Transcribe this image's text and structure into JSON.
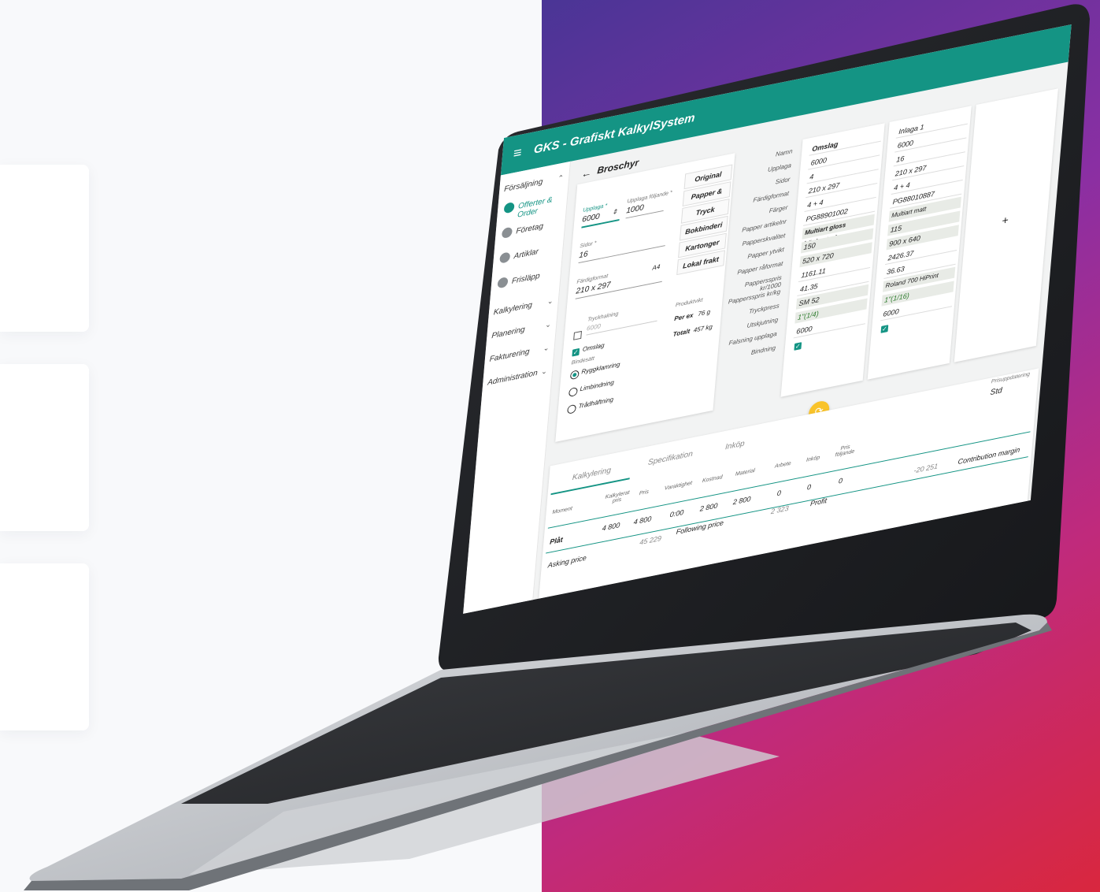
{
  "app": {
    "title": "GKS - Grafiskt KalkylSystem",
    "page_title": "Broschyr"
  },
  "sidebar": {
    "items": [
      {
        "label": "Försäljning"
      },
      {
        "label": "Offerter & Order"
      },
      {
        "label": "Företag"
      },
      {
        "label": "Artiklar"
      },
      {
        "label": "Frisläpp"
      },
      {
        "label": "Kalkylering"
      },
      {
        "label": "Planering"
      },
      {
        "label": "Fakturering"
      },
      {
        "label": "Administration"
      }
    ]
  },
  "form": {
    "upplaga_label": "Upplaga *",
    "upplaga_value": "6000",
    "upplaga_foljande_label": "Upplaga följande *",
    "upplaga_foljande_value": "1000",
    "sidor_label": "Sidor *",
    "sidor_value": "16",
    "fardigformat_label": "Färdigformat",
    "fardigformat_value": "210 x 297",
    "fardigformat_suffix": "A4",
    "tryckhalning_label": "Tryckhalning",
    "tryckhalning_value": "6000",
    "omslag_label": "Omslag",
    "bindesatt_label": "Bindesätt",
    "radio1": "Ryggklamring",
    "radio2": "Limbindning",
    "radio3": "Trådhäftning",
    "produktvikt_label": "Produktvikt",
    "per_ex_label": "Per ex",
    "per_ex_value": "76 g",
    "totalt_label": "Totalt",
    "totalt_value": "457 kg"
  },
  "buttons": [
    "Original",
    "Papper & Färg",
    "Tryck",
    "Bokbinderi",
    "Kartonger",
    "Lokal frakt"
  ],
  "row_labels": [
    "Namn",
    "Upplaga",
    "Sidor",
    "Färdigformat",
    "Färger",
    "Papper artikelnr",
    "Papperskvalitet",
    "Papper ytvikt",
    "Papper råformat",
    "Pappersspris kr/1000",
    "Pappersspris kr/kg",
    "Tryckpress",
    "Utskjutning",
    "Falsning upplaga",
    "Bindning"
  ],
  "omslag": [
    "Omslag",
    "6000",
    "4",
    "210 x 297",
    "4 + 4",
    "PG88901002",
    "Multiart gloss högbestruk",
    "150",
    "520 x 720",
    "1161.11",
    "41.35",
    "SM 52",
    "1\"(1/4)",
    "6000"
  ],
  "inlaga": [
    "Inlaga 1",
    "6000",
    "16",
    "210 x 297",
    "4 + 4",
    "PG88010887",
    "Multiart matt",
    "115",
    "900 x 640",
    "2426.37",
    "36.63",
    "Roland 700 HiPrint",
    "1\"(1/16)",
    "6000"
  ],
  "add_column": "+",
  "tabs": [
    "Kalkylering",
    "Specifikation",
    "Inköp"
  ],
  "prisuppdatering": {
    "label": "Prisuppdatering",
    "value": "Std"
  },
  "table": {
    "headers": [
      "Moment",
      "Kalkylerat pris",
      "Pris",
      "Varaktighet",
      "Kostnad",
      "Material",
      "Arbete",
      "Inköp",
      "Pris följande"
    ],
    "rows": [
      [
        "Plåt",
        "4 800",
        "4 800",
        "0:00",
        "2 800",
        "2 800",
        "0",
        "0",
        "0"
      ]
    ]
  },
  "summary": {
    "asking_price_label": "Asking price",
    "asking_price_value": "45 229",
    "following_price_label": "Following price",
    "following_price_value": "2 323",
    "profit_label": "Profit",
    "profit_value": "-20 251",
    "contribution_margin_label": "Contribution margin"
  },
  "colors": {
    "brand": "#149484",
    "fab": "#f9c32a",
    "gradient_start": "#4a3596",
    "gradient_end": "#d9273e"
  }
}
